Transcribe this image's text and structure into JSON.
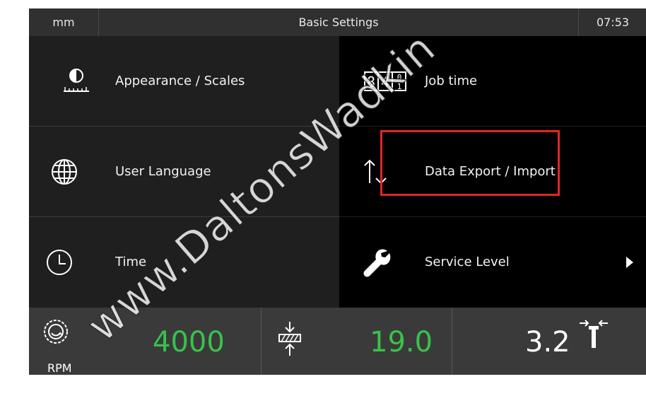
{
  "header": {
    "unit": "mm",
    "title": "Basic Settings",
    "time": "07:53"
  },
  "menu": {
    "left": [
      {
        "label": "Appearance / Scales",
        "icon": "contrast-scale-icon"
      },
      {
        "label": "User Language",
        "icon": "globe-icon"
      },
      {
        "label": "Time",
        "icon": "clock-icon"
      }
    ],
    "right": [
      {
        "label": "Job time",
        "icon": "digit-counter-icon",
        "icon_text": "84"
      },
      {
        "label": "Data Export / Import",
        "icon": "up-down-arrows-icon"
      },
      {
        "label": "Service Level",
        "icon": "wrench-icon"
      }
    ]
  },
  "status": {
    "rpm_value": "4000",
    "rpm_label": "RPM",
    "cut_value": "19.0",
    "width_value": "3.2"
  },
  "watermark": "www.DaltonsWadkin",
  "colors": {
    "accent_green": "#38c24a",
    "highlight_red": "#e2242b",
    "header_bg": "#303030"
  }
}
